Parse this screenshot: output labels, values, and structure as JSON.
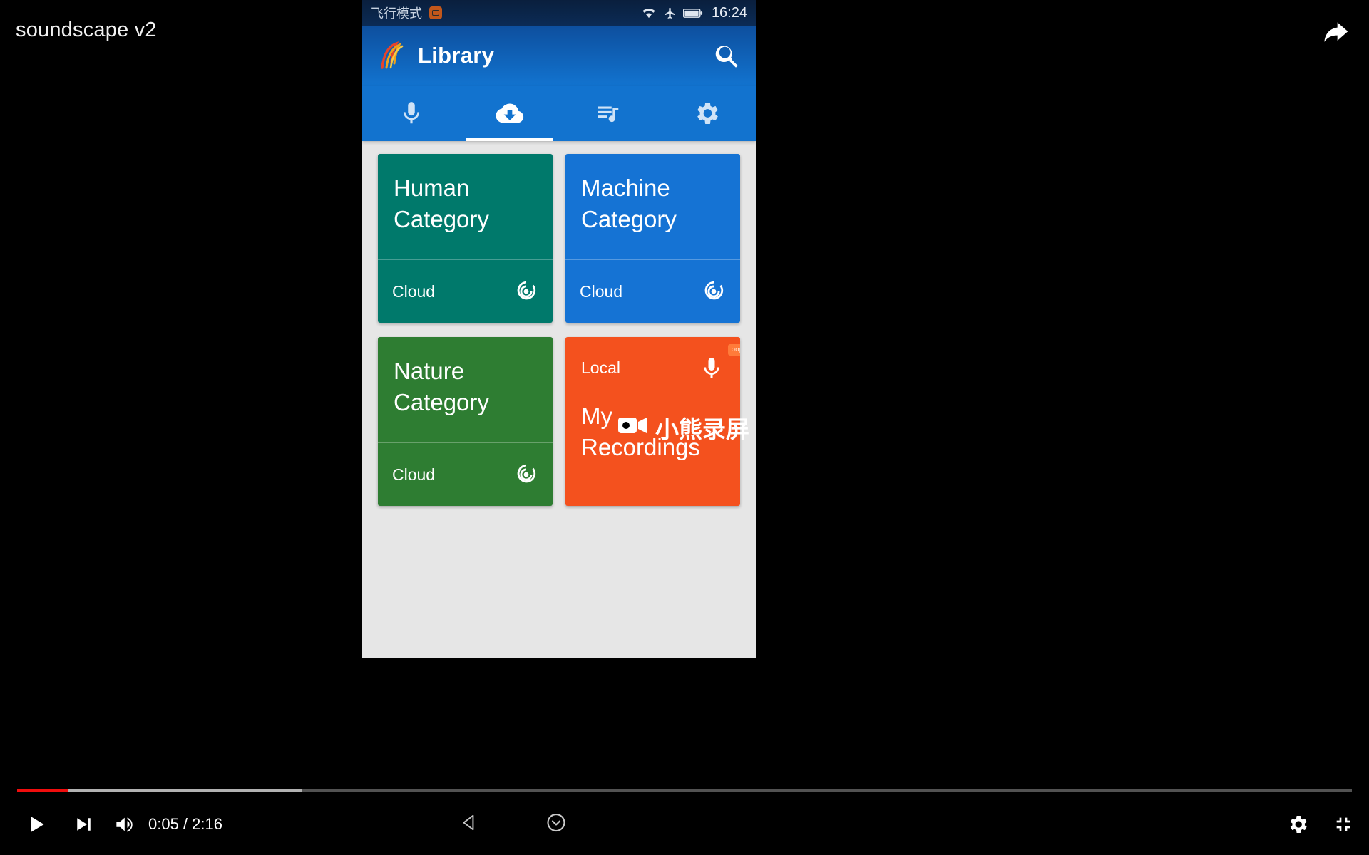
{
  "player": {
    "video_title": "soundscape v2",
    "current_time": "0:05",
    "total_time": "2:16",
    "time_display": "0:05 / 2:16",
    "play_label": "play-pause",
    "next_label": "next-video",
    "volume_label": "mute-volume",
    "settings_label": "settings",
    "fullscreen_label": "exit-fullscreen",
    "share_label": "share",
    "progress_percent": 3.7,
    "accent_color": "#f00d0d"
  },
  "watermark": {
    "text": "小熊录屏"
  },
  "softkeys": {
    "back_label": "back",
    "home_label": "home"
  },
  "phone": {
    "statusbar": {
      "mode_text": "飞行模式",
      "clock": "16:24",
      "icons": [
        "wifi-icon",
        "airplane-icon",
        "battery-icon"
      ]
    },
    "appbar": {
      "title": "Library",
      "logo_name": "app-logo",
      "search_label": "search"
    },
    "tabs": [
      {
        "id": "recorder",
        "icon": "microphone-icon",
        "active": false
      },
      {
        "id": "downloads",
        "icon": "cloud-download-icon",
        "active": true
      },
      {
        "id": "playlist",
        "icon": "playlist-icon",
        "active": false
      },
      {
        "id": "settings",
        "icon": "gear-icon",
        "active": false
      }
    ],
    "cards": [
      {
        "title": "Human Category",
        "source": "Cloud",
        "color": "#00796B",
        "theme": "card-teal",
        "icon": "track-changes-icon"
      },
      {
        "title": "Machine Category",
        "source": "Cloud",
        "color": "#1573d4",
        "theme": "card-blue",
        "icon": "track-changes-icon"
      },
      {
        "title": "Nature Category",
        "source": "Cloud",
        "color": "#2E7D32",
        "theme": "card-green",
        "icon": "track-changes-icon"
      }
    ],
    "recordings_card": {
      "source": "Local",
      "title": "My Recordings",
      "color": "#F4511E",
      "icon": "microphone-icon",
      "badge": "oops"
    }
  }
}
